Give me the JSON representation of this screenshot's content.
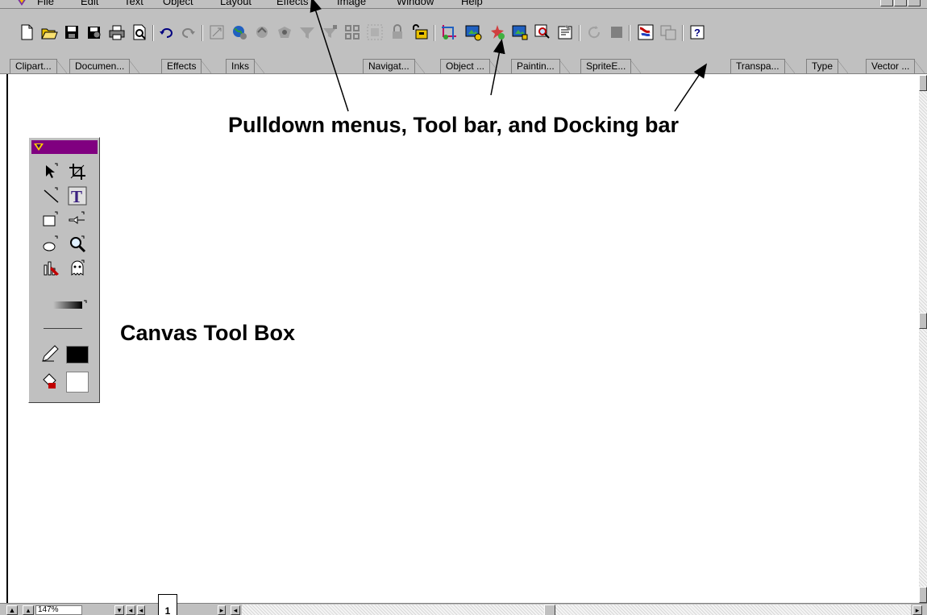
{
  "menubar": {
    "items": [
      {
        "label": "File"
      },
      {
        "label": "Edit"
      },
      {
        "label": "Text"
      },
      {
        "label": "Object"
      },
      {
        "label": "Layout"
      },
      {
        "label": "Effects"
      },
      {
        "label": "Image"
      },
      {
        "label": "Window"
      },
      {
        "label": "Help"
      }
    ]
  },
  "toolbar": {
    "buttons": [
      "new-icon",
      "open-icon",
      "save-icon",
      "save-all-icon",
      "print-icon",
      "print-preview-icon",
      "undo-icon",
      "redo-icon",
      "resize-icon",
      "web-icon",
      "rotate-icon",
      "shape-icon",
      "filter-icon",
      "effect-icon",
      "align-icon",
      "group-icon",
      "lock-icon",
      "unlock-icon",
      "crop-image-icon",
      "image-edit-icon",
      "image-effect-icon",
      "image-export-icon",
      "zoom-image-icon",
      "properties-icon",
      "refresh-icon",
      "stop-icon",
      "paint-icon",
      "sprite-icon",
      "help-icon"
    ]
  },
  "dockbar": {
    "tabs": [
      {
        "label": "Clipart..."
      },
      {
        "label": "Documen..."
      },
      {
        "label": "Effects"
      },
      {
        "label": "Inks"
      },
      {
        "label": "Navigat..."
      },
      {
        "label": "Object ..."
      },
      {
        "label": "Paintin..."
      },
      {
        "label": "SpriteE..."
      },
      {
        "label": "Transpa..."
      },
      {
        "label": "Type"
      },
      {
        "label": "Vector ..."
      }
    ]
  },
  "statusbar": {
    "zoom": "147%",
    "page": "1"
  },
  "annotations": {
    "top": "Pulldown menus, Tool bar, and Docking bar",
    "toolbox": "Canvas Tool Box"
  },
  "colors": {
    "chrome": "#c0c0c0",
    "toolbox_title": "#800080",
    "foreground_swatch": "#000000",
    "background_swatch": "#ffffff"
  }
}
